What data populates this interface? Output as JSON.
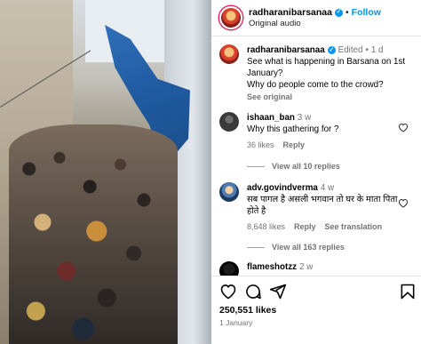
{
  "post": {
    "username": "radharanibarsanaa",
    "follow_label": "Follow",
    "audio": "Original audio",
    "caption_edited": "Edited",
    "caption_age": "1 d",
    "caption_line1": "See what is happening in Barsana on 1st January?",
    "caption_line2": "Why do people come to the crowd?",
    "see_original": "See original",
    "likes": "250,551 likes",
    "date": "1 January"
  },
  "comments": [
    {
      "username": "ishaan_ban",
      "age": "3 w",
      "text": "Why this gathering for ?",
      "likes": "36 likes",
      "reply": "Reply",
      "view_all": "View all 10 replies"
    },
    {
      "username": "adv.govindverma",
      "age": "4 w",
      "text": "सब पागल है असली भगवान तो घर के माता पिता होते है",
      "likes": "8,648 likes",
      "reply": "Reply",
      "translate": "See translation",
      "view_all": "View all 163 replies"
    },
    {
      "username": "flameshotzz",
      "age": "2 w"
    }
  ],
  "icons": {
    "verified": "verified-badge-icon",
    "more": "more-options-icon",
    "like": "heart-icon",
    "comment": "comment-icon",
    "share": "share-icon",
    "save": "bookmark-icon"
  },
  "colors": {
    "accent": "#0095f6",
    "muted": "#737373",
    "tarp": "#1f5aa0"
  }
}
